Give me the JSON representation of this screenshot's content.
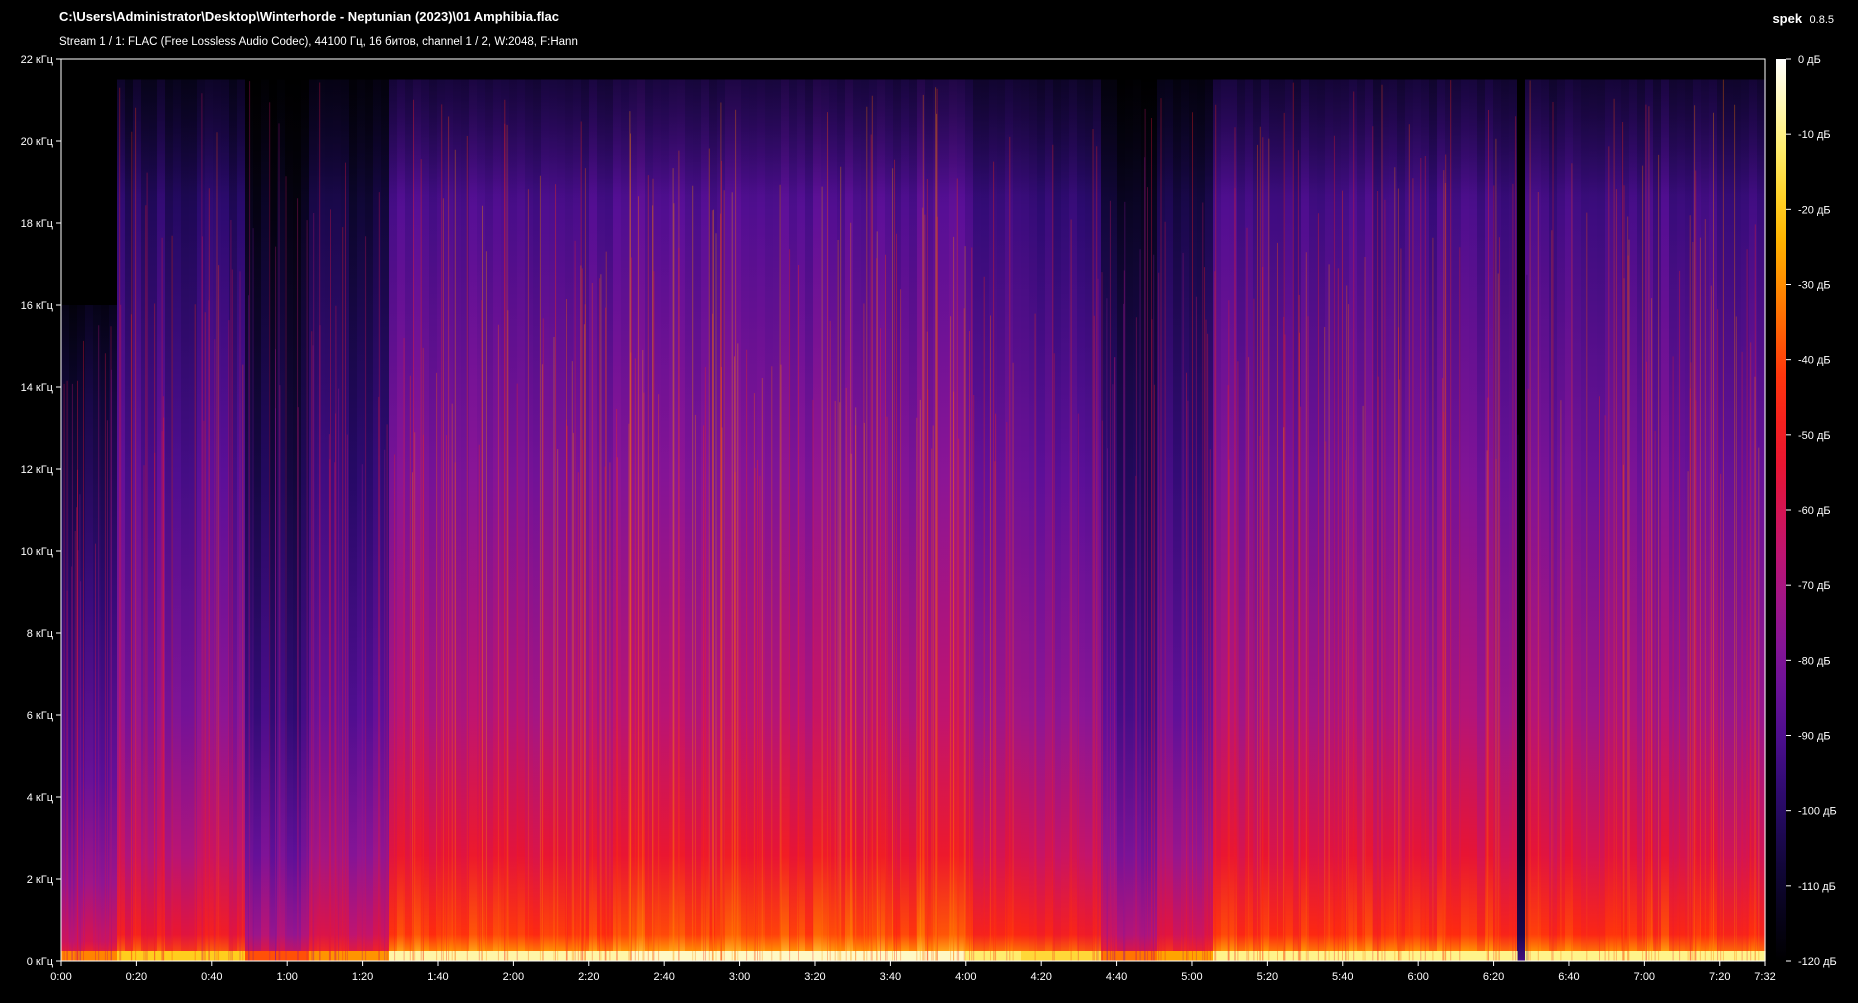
{
  "header": {
    "file_path": "C:\\Users\\Administrator\\Desktop\\Winterhorde - Neptunian (2023)\\01 Amphibia.flac",
    "stream_info": "Stream 1 / 1: FLAC (Free Lossless Audio Codec), 44100 Гц, 16 битов, channel 1 / 2, W:2048, F:Hann"
  },
  "app": {
    "name": "spek",
    "version": "0.8.5"
  },
  "colors": {
    "background": "#000000",
    "colormap": [
      "#000000",
      "#0d0630",
      "#2a0a6e",
      "#5a0f98",
      "#8c1596",
      "#c01470",
      "#e81434",
      "#ff2a0e",
      "#ff7a00",
      "#ffc200",
      "#fff27a",
      "#ffffff"
    ]
  },
  "chart_data": {
    "type": "heatmap",
    "title": "",
    "xlabel": "",
    "ylabel": "",
    "duration_seconds": 452,
    "xlim": [
      0,
      452
    ],
    "ylim_khz": [
      0,
      22
    ],
    "db_range": [
      -120,
      0
    ],
    "x_ticks": [
      "0:00",
      "0:20",
      "0:40",
      "1:00",
      "1:20",
      "1:40",
      "2:00",
      "2:20",
      "2:40",
      "3:00",
      "3:20",
      "3:40",
      "4:00",
      "4:20",
      "4:40",
      "5:00",
      "5:20",
      "5:40",
      "6:00",
      "6:20",
      "6:40",
      "7:00",
      "7:20",
      "7:32"
    ],
    "y_ticks": [
      "0 кГц",
      "2 кГц",
      "4 кГц",
      "6 кГц",
      "8 кГц",
      "10 кГц",
      "12 кГц",
      "14 кГц",
      "16 кГц",
      "18 кГц",
      "20 кГц",
      "22 кГц"
    ],
    "colorbar_ticks": [
      "0 дБ",
      "-10 дБ",
      "-20 дБ",
      "-30 дБ",
      "-40 дБ",
      "-50 дБ",
      "-60 дБ",
      "-70 дБ",
      "-80 дБ",
      "-90 дБ",
      "-100 дБ",
      "-110 дБ",
      "-120 дБ"
    ],
    "cutoff_khz": [
      {
        "from_s": 0,
        "to_s": 15,
        "khz": 16
      },
      {
        "from_s": 15,
        "to_s": 452,
        "khz": 21.5
      }
    ],
    "segments": [
      {
        "from_s": 0,
        "to_s": 15,
        "level": 0.62
      },
      {
        "from_s": 15,
        "to_s": 49,
        "level": 0.72
      },
      {
        "from_s": 49,
        "to_s": 66,
        "level": 0.56
      },
      {
        "from_s": 66,
        "to_s": 88,
        "level": 0.64
      },
      {
        "from_s": 88,
        "to_s": 150,
        "level": 0.82
      },
      {
        "from_s": 150,
        "to_s": 240,
        "level": 0.84
      },
      {
        "from_s": 240,
        "to_s": 255,
        "level": 0.78
      },
      {
        "from_s": 255,
        "to_s": 275,
        "level": 0.74
      },
      {
        "from_s": 275,
        "to_s": 290,
        "level": 0.6
      },
      {
        "from_s": 290,
        "to_s": 305,
        "level": 0.66
      },
      {
        "from_s": 305,
        "to_s": 386,
        "level": 0.8
      },
      {
        "from_s": 386,
        "to_s": 389,
        "level": 0.3
      },
      {
        "from_s": 389,
        "to_s": 452,
        "level": 0.8
      }
    ]
  }
}
